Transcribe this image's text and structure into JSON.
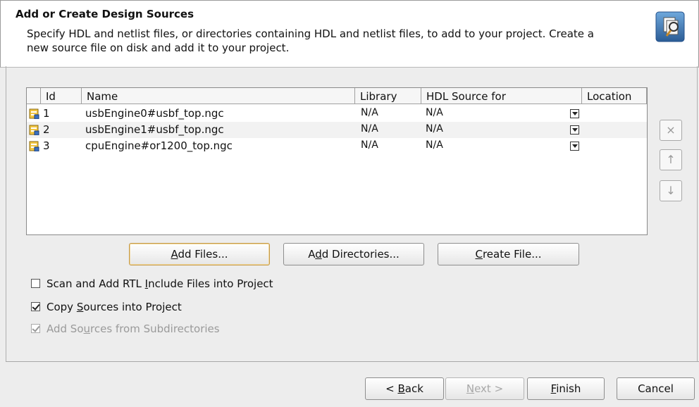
{
  "header": {
    "title": "Add or Create Design Sources",
    "description": "Specify HDL and netlist files, or directories containing HDL and netlist files, to add to your project. Create a new source file on disk and add it to your project.",
    "icon": "add-sources-wizard-icon"
  },
  "table": {
    "columns": [
      "Id",
      "Name",
      "Library",
      "HDL Source for",
      "Location"
    ],
    "rows": [
      {
        "id": "1",
        "name": "usbEngine0#usbf_top.ngc",
        "library": "N/A",
        "hdl_source_for": "N/A",
        "location": ""
      },
      {
        "id": "2",
        "name": "usbEngine1#usbf_top.ngc",
        "library": "N/A",
        "hdl_source_for": "N/A",
        "location": ""
      },
      {
        "id": "3",
        "name": "cpuEngine#or1200_top.ngc",
        "library": "N/A",
        "hdl_source_for": "N/A",
        "location": ""
      }
    ]
  },
  "side_buttons": {
    "remove": "×",
    "move_up": "↑",
    "move_down": "↓"
  },
  "buttons": {
    "add_files": {
      "pre": "",
      "key": "A",
      "post": "dd Files..."
    },
    "add_directories": {
      "pre": "A",
      "key": "d",
      "post": "d Directories..."
    },
    "create_file": {
      "pre": "",
      "key": "C",
      "post": "reate File..."
    }
  },
  "options": {
    "scan_rtl": {
      "pre": "Scan and Add RTL ",
      "key": "I",
      "post": "nclude Files into Project",
      "checked": false,
      "enabled": true
    },
    "copy_sources": {
      "pre": "Copy ",
      "key": "S",
      "post": "ources into Project",
      "checked": true,
      "enabled": true
    },
    "add_subdirs": {
      "pre": "Add So",
      "key": "u",
      "post": "rces from Subdirectories",
      "checked": true,
      "enabled": false
    }
  },
  "footer": {
    "back": {
      "pre": "< ",
      "key": "B",
      "post": "ack"
    },
    "next": {
      "pre": "",
      "key": "N",
      "post": "ext >"
    },
    "finish": {
      "pre": "",
      "key": "F",
      "post": "inish"
    },
    "cancel": "Cancel"
  }
}
